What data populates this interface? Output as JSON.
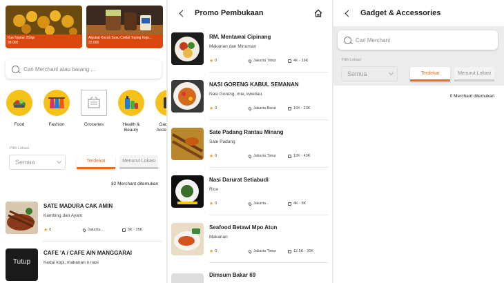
{
  "colors": {
    "accent": "#f06a1c",
    "banner_caption": "#d9480f",
    "category_circle": "#f6c21a",
    "star": "#f39a1a"
  },
  "home": {
    "banners": [
      {
        "title": "Kue Nastar 250gr",
        "price": "38.000"
      },
      {
        "title": "Alpukat Kocok Susu Coklat Toping Keju...",
        "price": "22.000"
      }
    ],
    "search_placeholder": "Cari Merchant atau barang ...",
    "categories": [
      {
        "label": "Food",
        "icon": "food-icon"
      },
      {
        "label": "Fashion",
        "icon": "fashion-icon"
      },
      {
        "label": "Groceries",
        "icon": "groceries-icon"
      },
      {
        "label": "Health & Beauty",
        "icon": "health-beauty-icon"
      },
      {
        "label": "Gadget & Accessories",
        "icon": "gadget-icon"
      }
    ],
    "location_label": "Pilih Lokasi",
    "location_value": "Semua",
    "sort_nearest": "Terdekat",
    "sort_by_location": "Menurut Lokasi",
    "merchant_count": "82 Merchant ditemukan",
    "merchants": [
      {
        "name": "SATE MADURA CAK AMIN",
        "desc": "Kambing dan Ayam",
        "rating": "0",
        "location": "Jakarta...",
        "price": "5K - 25K"
      },
      {
        "name": "CAFE 'A / CAFE AIN MANGGARAI",
        "desc": "Kedai kopi, makanan n nasi",
        "rating": "",
        "location": "",
        "price": "",
        "thumb_text": "Tutup"
      }
    ]
  },
  "promo": {
    "title": "Promo Pembukaan",
    "items": [
      {
        "name": "RM. Mentawai Cipinang",
        "desc": "Makanan dan Minuman",
        "rating": "0",
        "location": "Jakarta Timur",
        "price": "4K - 16K"
      },
      {
        "name": "NASI GORENG KABUL SEMANAN",
        "desc": "Nasi Goreng, mie, kwetiau",
        "rating": "0",
        "location": "Jakarta Barat",
        "price": "16K - 23K"
      },
      {
        "name": "Sate Padang Rantau Minang",
        "desc": "Sate Padang",
        "rating": "0",
        "location": "Jakarta Timur",
        "price": "12K - 40K"
      },
      {
        "name": "Nasi Darurat Setiabudi",
        "desc": "Rice",
        "rating": "0",
        "location": "Jakarta...",
        "price": "4K - 8K"
      },
      {
        "name": "Seafood Betawi Mpo Atun",
        "desc": "Makanan",
        "rating": "0",
        "location": "Jakarta Timur",
        "price": "12.5K - 30K"
      },
      {
        "name": "Dimsum Bakar 69",
        "desc": "",
        "rating": "",
        "location": "",
        "price": ""
      }
    ]
  },
  "gadget": {
    "title": "Gadget & Accessories",
    "search_placeholder": "Cari Merchant",
    "location_label": "Pilih Lokasi",
    "location_value": "Semua",
    "sort_nearest": "Terdekat",
    "sort_by_location": "Menurut Lokasi",
    "merchant_count": "0 Merchant ditemukan"
  }
}
